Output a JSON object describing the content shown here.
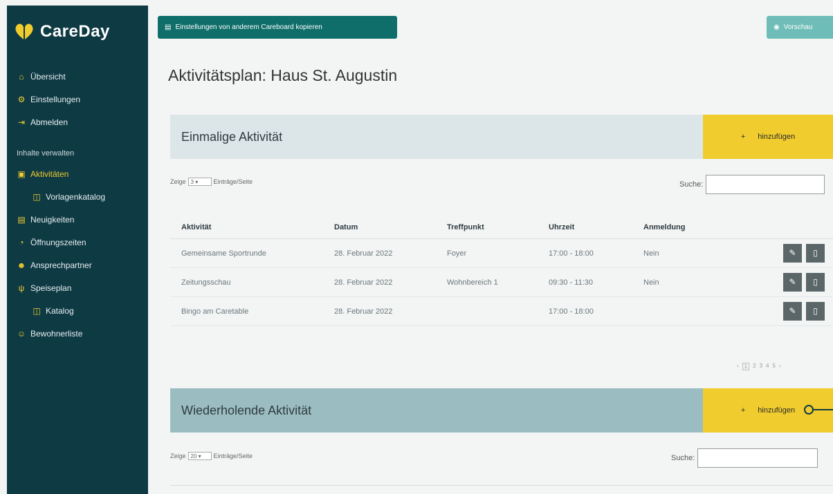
{
  "app": {
    "name": "CareDay"
  },
  "nav": {
    "items": [
      {
        "label": "Übersicht",
        "icon": "home-icon"
      },
      {
        "label": "Einstellungen",
        "icon": "gear-icon"
      },
      {
        "label": "Abmelden",
        "icon": "logout-icon"
      }
    ],
    "section_label": "Inhalte verwalten",
    "content_items": [
      {
        "label": "Aktivitäten",
        "icon": "bus-icon",
        "active": true
      },
      {
        "label": "Vorlagenkatalog",
        "icon": "book-icon",
        "sub": true
      },
      {
        "label": "Neuigkeiten",
        "icon": "news-icon"
      },
      {
        "label": "Öffnungszeiten",
        "icon": "clock-icon"
      },
      {
        "label": "Ansprechpartner",
        "icon": "user-circle-icon"
      },
      {
        "label": "Speiseplan",
        "icon": "cutlery-icon"
      },
      {
        "label": "Katalog",
        "icon": "book-icon",
        "sub": true
      },
      {
        "label": "Bewohnerliste",
        "icon": "users-icon"
      }
    ]
  },
  "toolbar": {
    "copy_label": "Einstellungen von anderem Careboard kopieren",
    "preview_label": "Vorschau"
  },
  "page": {
    "title": "Aktivitätsplan: Haus St. Augustin"
  },
  "single": {
    "title": "Einmalige Aktivität",
    "add_label": "hinzufügen",
    "add_symbol": "+",
    "show_label": "Zeige",
    "per_page": "3",
    "entries_label": "Einträge/Seite",
    "search_label": "Suche:",
    "columns": [
      "Aktivität",
      "Datum",
      "Treffpunkt",
      "Uhrzeit",
      "Anmeldung"
    ],
    "rows": [
      [
        "Gemeinsame Sportrunde",
        "28. Februar 2022",
        "Foyer",
        "17:00 - 18:00",
        "Nein"
      ],
      [
        "Zeitungsschau",
        "28. Februar 2022",
        "Wohnbereich 1",
        "09:30 - 11:30",
        "Nein"
      ],
      [
        "Bingo am Caretable",
        "28. Februar 2022",
        "",
        "17:00 - 18:00",
        ""
      ]
    ],
    "pagination": [
      "‹",
      "1",
      "2",
      "3",
      "4",
      "5",
      "›"
    ]
  },
  "recurring": {
    "title": "Wiederholende Aktivität",
    "add_label": "hinzufügen",
    "add_symbol": "+",
    "show_label": "Zeige",
    "per_page": "20",
    "entries_label": "Einträge/Seite",
    "search_label": "Suche:"
  },
  "colors": {
    "sidebar": "#0e3a44",
    "accent": "#f0cc2e",
    "teal": "#0f6e6a"
  }
}
